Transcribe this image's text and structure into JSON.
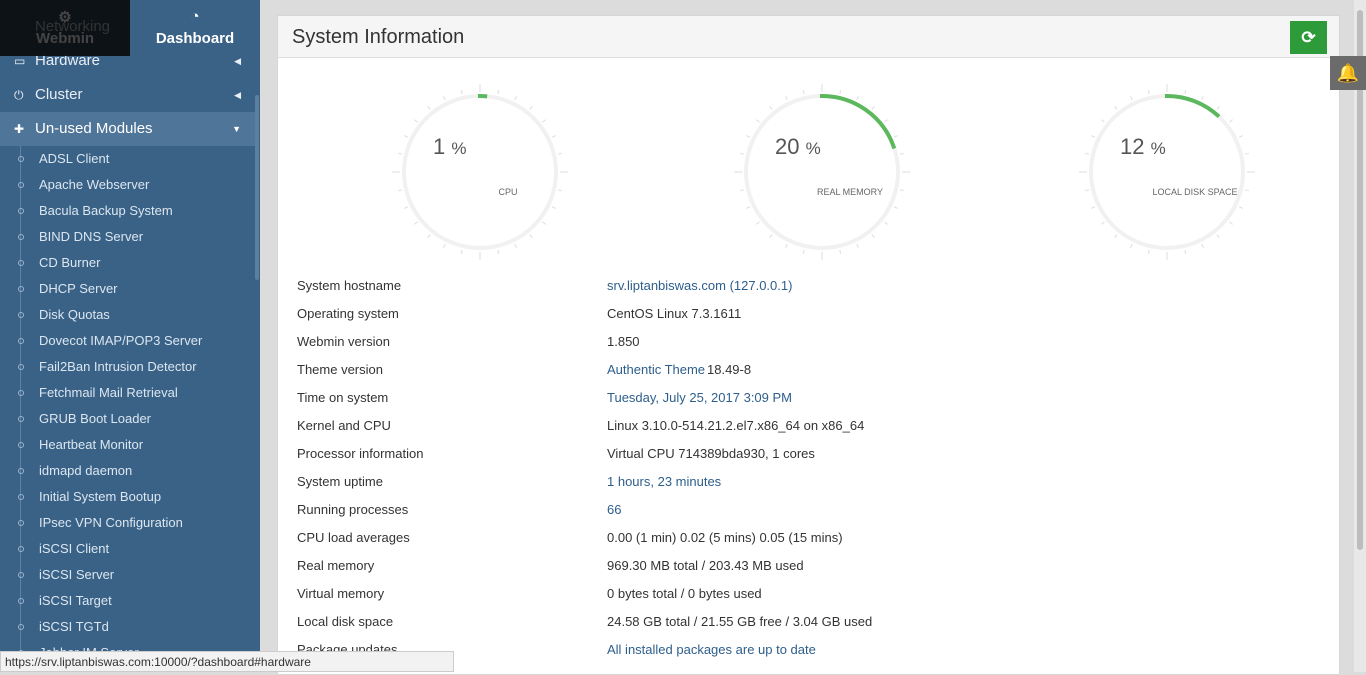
{
  "topbar": {
    "webmin_label": "Webmin",
    "dashboard_label": "Dashboard"
  },
  "sidebar": {
    "partial_category": "Networking",
    "categories": [
      {
        "label": "Hardware",
        "icon": "hdd-icon"
      },
      {
        "label": "Cluster",
        "icon": "power-icon"
      },
      {
        "label": "Un-used Modules",
        "icon": "puzzle-icon"
      }
    ],
    "modules": [
      "ADSL Client",
      "Apache Webserver",
      "Bacula Backup System",
      "BIND DNS Server",
      "CD Burner",
      "DHCP Server",
      "Disk Quotas",
      "Dovecot IMAP/POP3 Server",
      "Fail2Ban Intrusion Detector",
      "Fetchmail Mail Retrieval",
      "GRUB Boot Loader",
      "Heartbeat Monitor",
      "idmapd daemon",
      "Initial System Bootup",
      "IPsec VPN Configuration",
      "iSCSI Client",
      "iSCSI Server",
      "iSCSI Target",
      "iSCSI TGTd",
      "Jabber IM Server"
    ]
  },
  "panel": {
    "title": "System Information",
    "refresh_icon": "refresh-icon"
  },
  "gauges": [
    {
      "label": "CPU",
      "value": 1,
      "unit": "%"
    },
    {
      "label": "REAL MEMORY",
      "value": 20,
      "unit": "%"
    },
    {
      "label": "LOCAL DISK SPACE",
      "value": 12,
      "unit": "%"
    }
  ],
  "colors": {
    "gauge_fill": "#5cb85c",
    "sidebar": "#3a6287",
    "refresh": "#2e9b3a",
    "link": "#2d5e8c"
  },
  "info": [
    {
      "k": "System hostname",
      "v": "srv.liptanbiswas.com (127.0.0.1)",
      "link": true
    },
    {
      "k": "Operating system",
      "v": "CentOS Linux 7.3.1611"
    },
    {
      "k": "Webmin version",
      "v": "1.850"
    },
    {
      "k": "Theme version",
      "v": "Authentic Theme",
      "v2": " 18.49-8",
      "link": true
    },
    {
      "k": "Time on system",
      "v": "Tuesday, July 25, 2017 3:09 PM",
      "link": true
    },
    {
      "k": "Kernel and CPU",
      "v": "Linux 3.10.0-514.21.2.el7.x86_64 on x86_64"
    },
    {
      "k": "Processor information",
      "v": "Virtual CPU 714389bda930, 1 cores"
    },
    {
      "k": "System uptime",
      "v": "1 hours, 23 minutes",
      "link": true
    },
    {
      "k": "Running processes",
      "v": "66",
      "link": true
    },
    {
      "k": "CPU load averages",
      "v": "0.00 (1 min) 0.02 (5 mins) 0.05 (15 mins)"
    },
    {
      "k": "Real memory",
      "v": "969.30 MB total / 203.43 MB used"
    },
    {
      "k": "Virtual memory",
      "v": "0 bytes total / 0 bytes used"
    },
    {
      "k": "Local disk space",
      "v": "24.58 GB total / 21.55 GB free / 3.04 GB used"
    },
    {
      "k": "Package updates",
      "v": "All installed packages are up to date",
      "link": true
    }
  ],
  "statusbar": {
    "url": "https://srv.liptanbiswas.com:10000/?dashboard#hardware"
  }
}
